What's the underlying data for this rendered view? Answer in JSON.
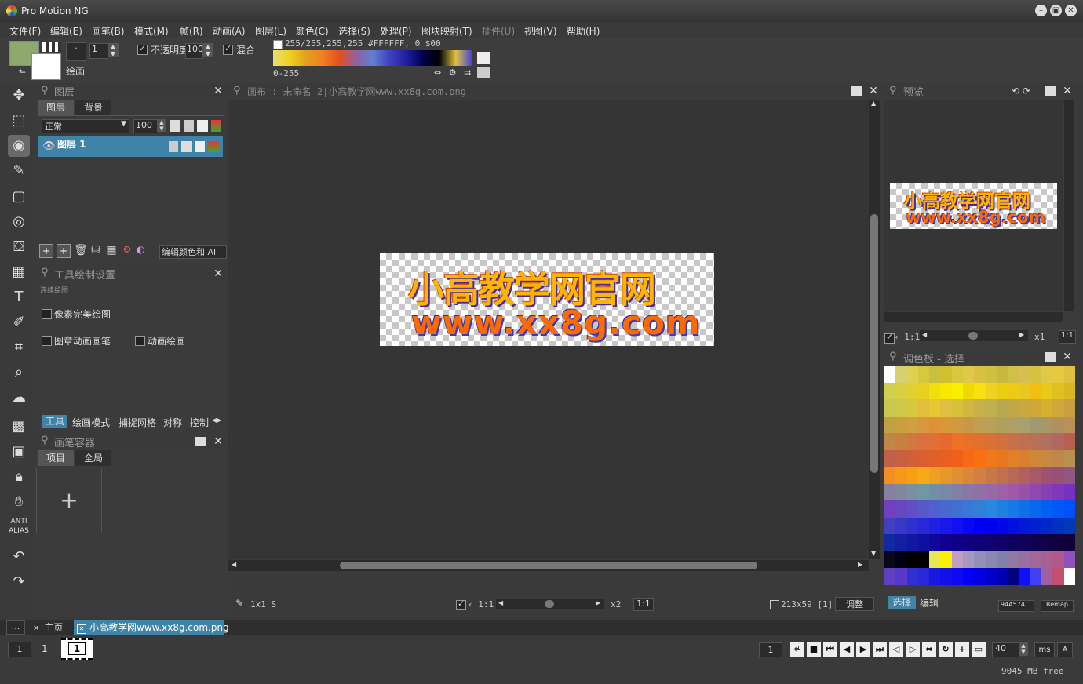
{
  "window": {
    "title": "Pro Motion NG"
  },
  "menu": [
    {
      "label": "文件(F)"
    },
    {
      "label": "编辑(E)"
    },
    {
      "label": "画笔(B)"
    },
    {
      "label": "模式(M)"
    },
    {
      "label": "帧(R)"
    },
    {
      "label": "动画(A)"
    },
    {
      "label": "图层(L)"
    },
    {
      "label": "颜色(C)"
    },
    {
      "label": "选择(S)"
    },
    {
      "label": "处理(P)"
    },
    {
      "label": "图块映射(T)"
    },
    {
      "label": "插件(U)"
    },
    {
      "label": "视图(V)"
    },
    {
      "label": "帮助(H)"
    }
  ],
  "toolbar": {
    "fg_color": "#8fa86e",
    "bg_color": "#ffffff",
    "draw_label": "绘画",
    "size_value": "1",
    "opacity_label": "不透明度",
    "opacity_value": "100",
    "blend_label": "混合",
    "color_info": "255/255,255,255 #FFFFFF, 0 $00",
    "range_label": "0-255"
  },
  "layers_panel": {
    "title": "图层",
    "tabs": [
      "图层",
      "背景"
    ],
    "mode": "正常",
    "opacity": "100",
    "layer_name": "图层 1",
    "edit_color_label": "编辑颜色和 Al"
  },
  "tool_settings": {
    "title": "工具绘制设置",
    "section": "连续绘图",
    "pixel_perfect": "像素完美绘图",
    "stamp_anim": "图章动画画笔",
    "anim_draw": "动画绘画",
    "tabs": [
      "工具",
      "绘画模式",
      "捕捉网格",
      "对称",
      "控制"
    ]
  },
  "brush_container": {
    "title": "画笔容器",
    "tabs": [
      "项目",
      "全局"
    ]
  },
  "canvas": {
    "title": "画布 : 未命名 2|小高教学网www.xx8g.com.png",
    "line1": "小高教学网官网",
    "line2": "www.xx8g.com",
    "status_brush": "1x1 S",
    "zoom_ratio": "1:1",
    "zoom_factor": "x2",
    "zoom_box": "1:1",
    "image_size": "213x59 [1]",
    "adjust": "调整"
  },
  "preview": {
    "title": "预览",
    "zoom_ratio": "1:1",
    "zoom_factor": "x1",
    "zoom_box": "1:1"
  },
  "palette": {
    "title": "调色板 - 选择",
    "tab_select": "选择",
    "tab_edit": "编辑",
    "hex": "94A574",
    "remap": "Remap"
  },
  "tabs_bottom": {
    "more": "...",
    "home": "主页",
    "file": "小高教学网www.xx8g.com.png"
  },
  "timeline": {
    "frame_box": "1",
    "frame_num": "1",
    "frame_thumb": "1",
    "current_frame": "1",
    "delay": "40",
    "unit": "ms",
    "auto": "A",
    "memory": "9045 MB free"
  }
}
